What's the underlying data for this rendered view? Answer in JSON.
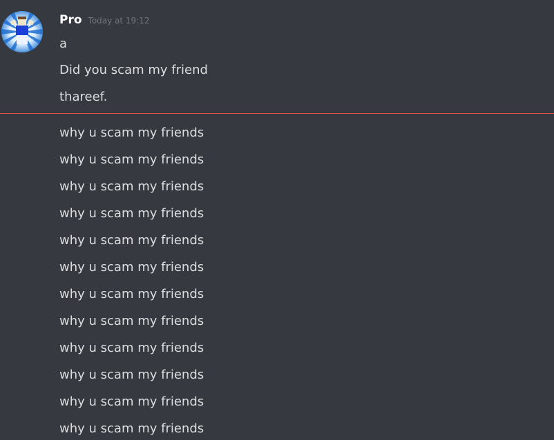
{
  "author": {
    "name": "Pro",
    "timestamp": "Today at 19:12",
    "avatar": "avatar"
  },
  "messages_before_divider": [
    "a",
    "Did you scam my friend",
    "thareef."
  ],
  "messages_after_divider": [
    "why u scam my friends",
    "why u scam my friends",
    "why u scam my friends",
    "why u scam my friends",
    "why u scam my friends",
    "why u scam my friends",
    "why u scam my friends",
    "why u scam my friends",
    "why u scam my friends",
    "why u scam my friends",
    "why u scam my friends",
    "why u scam my friends"
  ],
  "colors": {
    "background": "#36393f",
    "text": "#dcddde",
    "username": "#ffffff",
    "timestamp": "#72767d",
    "new_messages_divider": "#d9544d"
  }
}
